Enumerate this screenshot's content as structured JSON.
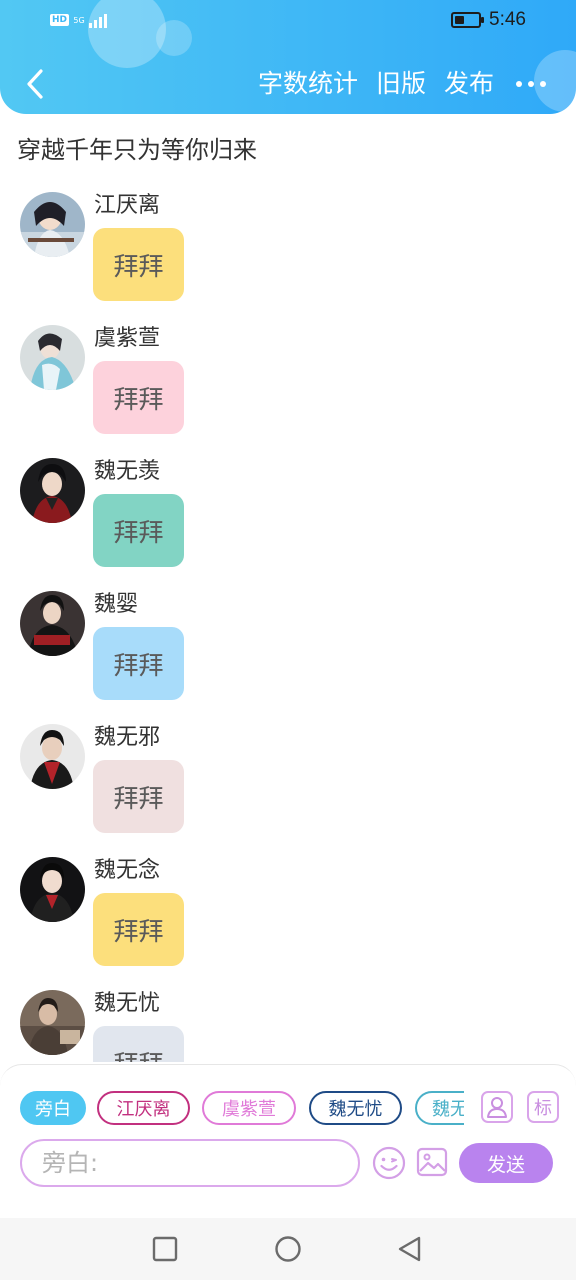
{
  "status_bar": {
    "hd_label": "HD",
    "network_label": "5G",
    "time": "5:46",
    "battery_level": 0.4
  },
  "header": {
    "back_icon": "chevron-left-icon",
    "actions": [
      "字数统计",
      "旧版",
      "发布"
    ],
    "more_icon": "more-horizontal-icon",
    "colors": {
      "gradient_start": "#52c8f3",
      "gradient_end": "#2fa9f8"
    }
  },
  "story": {
    "title": "穿越千年只为等你归来"
  },
  "messages": [
    {
      "speaker": "江厌离",
      "text": "拜拜",
      "bubble_color": "#fcdf7c"
    },
    {
      "speaker": "虞紫萱",
      "text": "拜拜",
      "bubble_color": "#fdd2dc"
    },
    {
      "speaker": "魏无羡",
      "text": "拜拜",
      "bubble_color": "#82d4c4"
    },
    {
      "speaker": "魏婴",
      "text": "拜拜",
      "bubble_color": "#a8dcfa"
    },
    {
      "speaker": "魏无邪",
      "text": "拜拜",
      "bubble_color": "#f0e0e0"
    },
    {
      "speaker": "魏无念",
      "text": "拜拜",
      "bubble_color": "#fcdf7c"
    },
    {
      "speaker": "魏无忧",
      "text": "拜拜",
      "bubble_color": "#e1e6ee"
    }
  ],
  "composer": {
    "roles": [
      {
        "label": "旁白",
        "color": "#4fc7f2",
        "active": true
      },
      {
        "label": "江厌离",
        "color": "#c2307f",
        "active": false
      },
      {
        "label": "虞紫萱",
        "color": "#e07ad8",
        "active": false
      },
      {
        "label": "魏无忧",
        "color": "#1f4b86",
        "active": false
      },
      {
        "label": "魏无",
        "color": "#4ab0c8",
        "active": false
      }
    ],
    "role_icon": "person-icon",
    "tag_label": "标",
    "placeholder": "旁白:",
    "emoji_icon": "emoji-icon",
    "image_icon": "image-icon",
    "send_label": "发送",
    "send_color": "#b983ee"
  },
  "nav": {
    "icons": [
      "square-icon",
      "circle-icon",
      "triangle-back-icon"
    ]
  }
}
